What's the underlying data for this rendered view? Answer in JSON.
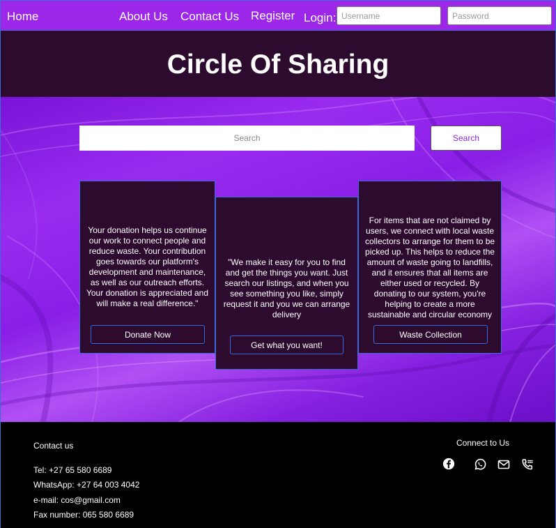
{
  "nav": {
    "home": "Home",
    "about": "About Us",
    "contact": "Contact Us",
    "register": "Register",
    "login_label": "Login:",
    "username_placeholder": "Username",
    "password_placeholder": "Password"
  },
  "header": {
    "title": "Circle Of Sharing"
  },
  "search": {
    "placeholder": "Search",
    "button_label": "Search"
  },
  "cards": [
    {
      "text": "Your donation helps us continue our work to connect people and reduce waste. Your contribution goes towards our platform's development and maintenance, as well as our outreach efforts. Your donation is appreciated and will make a real difference.\"",
      "button_label": "Donate  Now"
    },
    {
      "text": "\"We make it easy for you to find and get the things you want. Just search our listings, and when you see something you like, simply request it and you we can arrange delivery",
      "button_label": "Get what you want!"
    },
    {
      "text": "For items that are not claimed by users, we connect with local waste collectors to arrange for them to be picked up. This helps to reduce the amount of waste going to landfills, and it ensures that all items are either used or recycled. By donating to our system, you're helping to create a more sustainable and circular economy",
      "button_label": "Waste Collection"
    }
  ],
  "footer": {
    "contact_heading": "Contact us",
    "tel": "Tel: +27 65 580 6689",
    "whatsapp": "WhatsApp: +27 64 003 4042",
    "email": "e-mail: cos@gmail.com",
    "fax": "Fax number: 065 580 6689",
    "connect_heading": "Connect to Us",
    "social_icons": [
      "facebook-icon",
      "whatsapp-icon",
      "mail-icon",
      "phone-icon"
    ]
  },
  "colors": {
    "nav_bg": "#9d27e8",
    "header_bg": "#2d0b2e",
    "card_bg": "#2d0b2e",
    "accent_border": "#3a6bd6",
    "search_button_text": "#8a2be2",
    "footer_bg": "#000000"
  }
}
